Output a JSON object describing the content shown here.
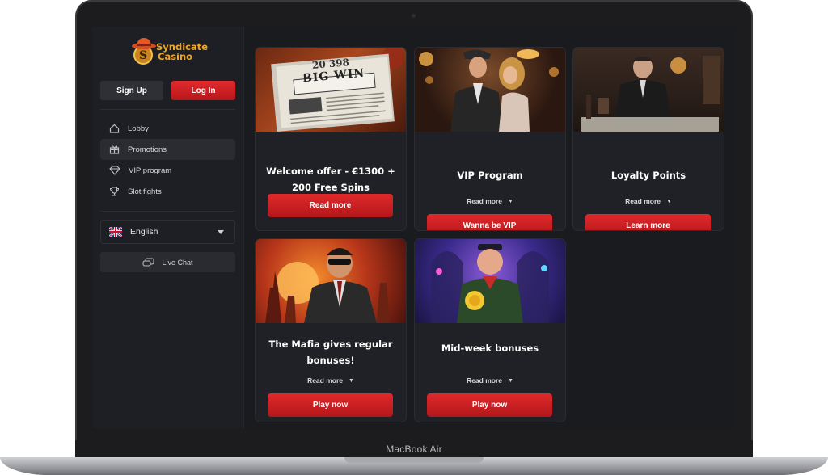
{
  "device": {
    "label": "MacBook Air"
  },
  "brand": {
    "line1": "Syndicate",
    "line2": "Casino"
  },
  "auth": {
    "signup_label": "Sign Up",
    "login_label": "Log In"
  },
  "nav": [
    {
      "label": "Lobby",
      "icon": "home-icon",
      "active": false
    },
    {
      "label": "Promotions",
      "icon": "gift-icon",
      "active": true
    },
    {
      "label": "VIP program",
      "icon": "diamond-icon",
      "active": false
    },
    {
      "label": "Slot fights",
      "icon": "trophy-icon",
      "active": false
    }
  ],
  "language": {
    "selected": "English",
    "flag": "uk-flag-icon"
  },
  "chat": {
    "label": "Live Chat",
    "icon": "chat-icon"
  },
  "cards": [
    {
      "title": "Welcome offer - €1300 + 200 Free Spins",
      "read_more": "",
      "cta": "Read more",
      "newspaper": {
        "number": "20 398",
        "headline": "BIG WIN"
      }
    },
    {
      "title": "VIP Program",
      "read_more": "Read more",
      "cta": "Wanna be VIP"
    },
    {
      "title": "Loyalty Points",
      "read_more": "Read more",
      "cta": "Learn more"
    },
    {
      "title": "The Mafia gives regular bonuses!",
      "read_more": "Read more",
      "cta": "Play now"
    },
    {
      "title": "Mid-week bonuses",
      "read_more": "Read more",
      "cta": "Play now"
    }
  ],
  "colors": {
    "accent": "#d42226",
    "gold": "#e9a62b",
    "background": "#1a1b1f",
    "sidebar": "#1e1f24",
    "card": "#202126"
  }
}
